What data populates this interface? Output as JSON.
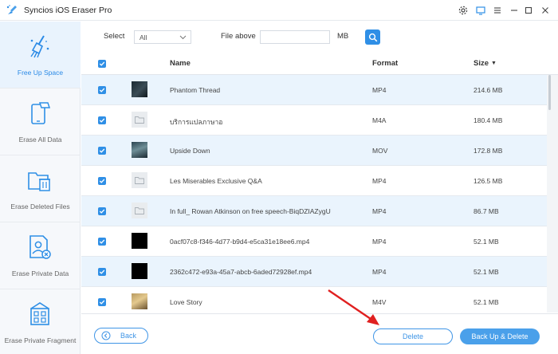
{
  "window": {
    "title": "Syncios iOS Eraser Pro",
    "controls": [
      "settings-icon",
      "feedback-icon",
      "menu-icon",
      "minimize-icon",
      "maximize-icon",
      "close-icon"
    ]
  },
  "sidebar": {
    "items": [
      {
        "label": "Free Up Space",
        "icon": "broom-icon",
        "active": true
      },
      {
        "label": "Erase All Data",
        "icon": "phone-erase-icon",
        "active": false
      },
      {
        "label": "Erase Deleted Files",
        "icon": "folder-trash-icon",
        "active": false
      },
      {
        "label": "Erase Private Data",
        "icon": "private-data-icon",
        "active": false
      },
      {
        "label": "Erase Private Fragment",
        "icon": "fragment-icon",
        "active": false
      }
    ]
  },
  "toolbar": {
    "select_label": "Select",
    "select_value": "All",
    "file_above_label": "File above",
    "size_value": "",
    "unit": "MB",
    "search_icon": "search-icon"
  },
  "table": {
    "headers": {
      "name": "Name",
      "format": "Format",
      "size": "Size"
    },
    "sort_indicator": "▼",
    "rows": [
      {
        "name": "Phantom Thread",
        "format": "MP4",
        "size": "214.6 MB",
        "thumb": "dark"
      },
      {
        "name": "บริการแปลภาษาอ",
        "format": "M4A",
        "size": "180.4 MB",
        "thumb": "folder"
      },
      {
        "name": "Upside Down",
        "format": "MOV",
        "size": "172.8 MB",
        "thumb": "teal"
      },
      {
        "name": "Les Miserables Exclusive Q&A",
        "format": "MP4",
        "size": "126.5 MB",
        "thumb": "folder"
      },
      {
        "name": "In full_ Rowan Atkinson on free speech-BiqDZIAZygU",
        "format": "MP4",
        "size": "86.7 MB",
        "thumb": "folder"
      },
      {
        "name": "0acf07c8-f346-4d77-b9d4-e5ca31e18ee6.mp4",
        "format": "MP4",
        "size": "52.1 MB",
        "thumb": "black"
      },
      {
        "name": "2362c472-e93a-45a7-abcb-6aded72928ef.mp4",
        "format": "MP4",
        "size": "52.1 MB",
        "thumb": "black"
      },
      {
        "name": "Love Story",
        "format": "M4V",
        "size": "52.1 MB",
        "thumb": "warm"
      }
    ]
  },
  "footer": {
    "back_label": "Back",
    "delete_label": "Delete",
    "backup_delete_label": "Back Up & Delete"
  },
  "colors": {
    "accent": "#2f8fe6",
    "row_highlight": "#eaf4fd",
    "annotation_arrow": "#e02020"
  }
}
